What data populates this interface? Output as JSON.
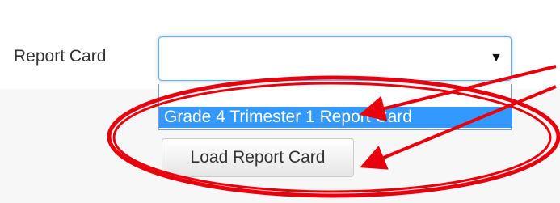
{
  "form": {
    "report_card_label": "Report Card",
    "select_value": "",
    "caret_glyph": "▼"
  },
  "dropdown": {
    "highlighted_option": "Grade 4 Trimester 1 Report Card"
  },
  "actions": {
    "load_button_label": "Load Report Card"
  },
  "annotation": {
    "color": "#e8000d"
  }
}
